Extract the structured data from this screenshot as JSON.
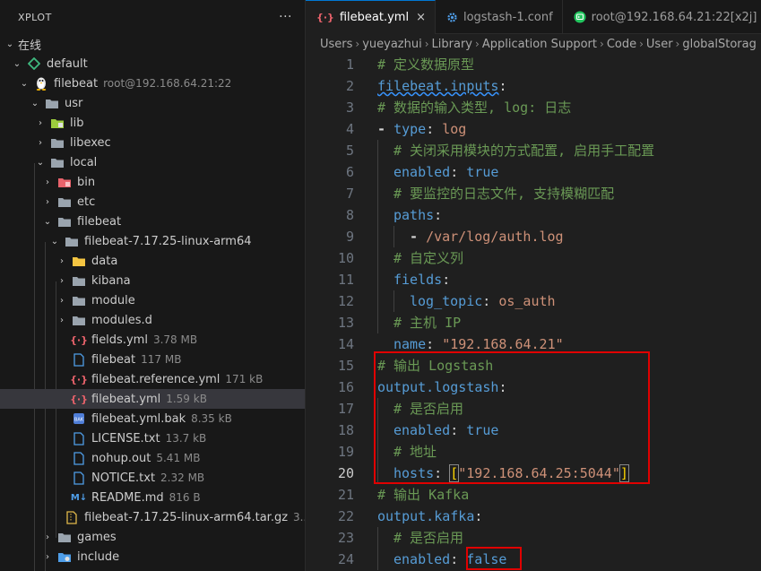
{
  "sidebar": {
    "title": "XPLOT",
    "more_label": "···",
    "online_label": "在线",
    "group": "default",
    "host": {
      "name": "filebeat",
      "address": "root@192.168.64.21:22"
    },
    "items": [
      {
        "name": "usr",
        "kind": "folder"
      },
      {
        "name": "lib",
        "kind": "folder"
      },
      {
        "name": "libexec",
        "kind": "folder"
      },
      {
        "name": "local",
        "kind": "folder"
      },
      {
        "name": "bin",
        "kind": "folder"
      },
      {
        "name": "etc",
        "kind": "folder"
      },
      {
        "name": "filebeat",
        "kind": "folder"
      },
      {
        "name": "filebeat-7.17.25-linux-arm64",
        "kind": "folder"
      },
      {
        "name": "data",
        "kind": "folder"
      },
      {
        "name": "kibana",
        "kind": "folder"
      },
      {
        "name": "module",
        "kind": "folder"
      },
      {
        "name": "modules.d",
        "kind": "folder"
      },
      {
        "name": "fields.yml",
        "size": "3.78 MB",
        "kind": "yml"
      },
      {
        "name": "filebeat",
        "size": "117 MB",
        "kind": "file"
      },
      {
        "name": "filebeat.reference.yml",
        "size": "171 kB",
        "kind": "yml"
      },
      {
        "name": "filebeat.yml",
        "size": "1.59 kB",
        "kind": "yml"
      },
      {
        "name": "filebeat.yml.bak",
        "size": "8.35 kB",
        "kind": "bak"
      },
      {
        "name": "LICENSE.txt",
        "size": "13.7 kB",
        "kind": "file"
      },
      {
        "name": "nohup.out",
        "size": "5.41 MB",
        "kind": "file"
      },
      {
        "name": "NOTICE.txt",
        "size": "2.32 MB",
        "kind": "file"
      },
      {
        "name": "README.md",
        "size": "816 B",
        "kind": "md"
      },
      {
        "name": "filebeat-7.17.25-linux-arm64.tar.gz",
        "size": "3...",
        "kind": "file"
      },
      {
        "name": "games",
        "kind": "folder"
      },
      {
        "name": "include",
        "kind": "folder"
      }
    ]
  },
  "tabs": [
    {
      "label": "filebeat.yml",
      "close": "×"
    },
    {
      "label": "logstash-1.conf"
    },
    {
      "label": "root@192.168.64.21:22[x2j]"
    }
  ],
  "breadcrumb": [
    "Users",
    "yueyazhui",
    "Library",
    "Application Support",
    "Code",
    "User",
    "globalStorag"
  ],
  "code": {
    "line_numbers": [
      "1",
      "2",
      "3",
      "4",
      "5",
      "6",
      "7",
      "8",
      "9",
      "10",
      "11",
      "12",
      "13",
      "14",
      "15",
      "16",
      "17",
      "18",
      "19",
      "20",
      "21",
      "22",
      "23",
      "24"
    ],
    "l1": "# 定义数据原型",
    "l2_key": "filebeat.inputs",
    "l2_colon": ":",
    "l3": "# 数据的输入类型, log: 日志",
    "l4_dash": "- ",
    "l4_key": "type",
    "l4_colon": ": ",
    "l4_val": "log",
    "l5": "# 关闭采用模块的方式配置, 启用手工配置",
    "l6_key": "enabled",
    "l6_colon": ": ",
    "l6_val": "true",
    "l7": "# 要监控的日志文件, 支持模糊匹配",
    "l8_key": "paths",
    "l8_colon": ":",
    "l9_dash": "- ",
    "l9_val": "/var/log/auth.log",
    "l10": "# 自定义列",
    "l11_key": "fields",
    "l11_colon": ":",
    "l12_key": "log_topic",
    "l12_colon": ": ",
    "l12_val": "os_auth",
    "l13": "# 主机 IP",
    "l14_key": "name",
    "l14_colon": ": ",
    "l14_val": "\"192.168.64.21\"",
    "l15": "# 输出 Logstash",
    "l16_key": "output.logstash",
    "l16_colon": ":",
    "l17": "# 是否启用",
    "l18_key": "enabled",
    "l18_colon": ": ",
    "l18_val": "true",
    "l19": "# 地址",
    "l20_key": "hosts",
    "l20_colon": ": ",
    "l20_open": "[",
    "l20_val": "\"192.168.64.25:5044\"",
    "l20_close": "]",
    "l21": "# 输出 Kafka",
    "l22_key": "output.kafka",
    "l22_colon": ":",
    "l23": "# 是否启用",
    "l24_key": "enabled",
    "l24_colon": ": ",
    "l24_val": "false"
  },
  "colors": {
    "comment": "#6a9955",
    "key": "#569cd6",
    "string": "#ce9178",
    "highlight": "#e00000",
    "accent": "#0078d4"
  }
}
